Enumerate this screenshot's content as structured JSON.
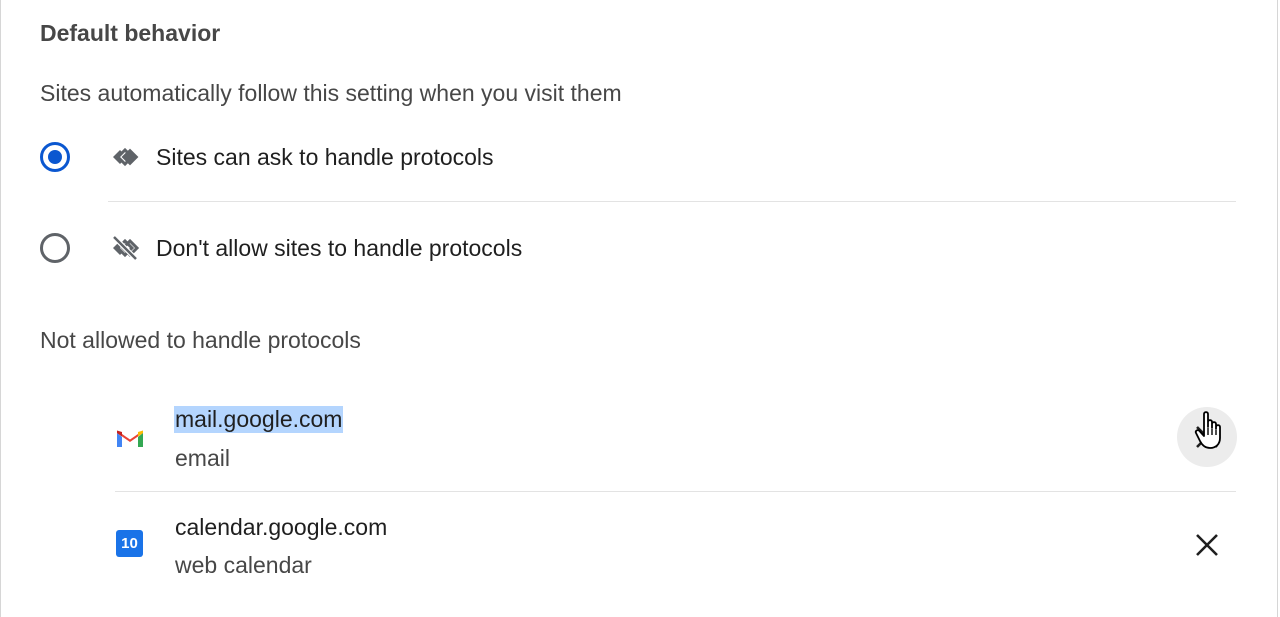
{
  "default_behavior": {
    "title": "Default behavior",
    "description": "Sites automatically follow this setting when you visit them",
    "options": [
      {
        "label": "Sites can ask to handle protocols",
        "icon": "protocol-handler-icon",
        "selected": true
      },
      {
        "label": "Don't allow sites to handle protocols",
        "icon": "protocol-handler-off-icon",
        "selected": false
      }
    ]
  },
  "not_allowed": {
    "title": "Not allowed to handle protocols",
    "sites": [
      {
        "site": "mail.google.com",
        "protocol": "email",
        "favicon": "gmail-icon",
        "action_icon": "close-icon",
        "text_selected": true
      },
      {
        "site": "calendar.google.com",
        "protocol": "web calendar",
        "favicon": "google-calendar-icon",
        "favicon_text": "10",
        "action_icon": "close-icon",
        "text_selected": false
      }
    ]
  },
  "colors": {
    "accent": "#0b57d0",
    "selection": "#b4d5fe",
    "hover": "#ececec"
  }
}
